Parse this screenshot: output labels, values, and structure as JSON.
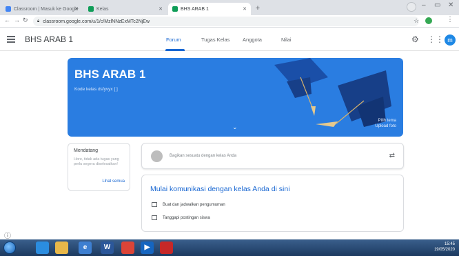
{
  "browser": {
    "tabs": [
      {
        "title": "Classroom | Masuk ke Google",
        "active": false
      },
      {
        "title": "Kelas",
        "active": false
      },
      {
        "title": "BHS ARAB 1",
        "active": true
      }
    ],
    "url": "classroom.google.com/u/1/c/MzlNNzExMTc2NjEw"
  },
  "header": {
    "class_title": "BHS ARAB 1",
    "tabs": [
      {
        "label": "Forum",
        "active": true
      },
      {
        "label": "Tugas Kelas",
        "active": false
      },
      {
        "label": "Anggota",
        "active": false
      },
      {
        "label": "Nilai",
        "active": false
      }
    ],
    "avatar_initial": "m"
  },
  "banner": {
    "title": "BHS ARAB 1",
    "class_code": "Kode kelas  dsfyvyx [ ]",
    "info_line1": "Pilih tema",
    "info_line2": "Upload foto",
    "bg_color": "#2a7de1"
  },
  "upcoming": {
    "title": "Mendatang",
    "text": "Hore, tidak ada tugas yang perlu segera diselesaikan!",
    "view_all": "Lihat semua"
  },
  "stream": {
    "share_placeholder": "Bagikan sesuatu dengan kelas Anda",
    "empty_title": "Mulai komunikasi dengan kelas Anda di sini",
    "rows": [
      "Buat dan jadwalkan pengumuman",
      "Tanggapi postingan siswa"
    ]
  },
  "taskbar": {
    "time": "15:45",
    "date": "19/05/2020"
  }
}
